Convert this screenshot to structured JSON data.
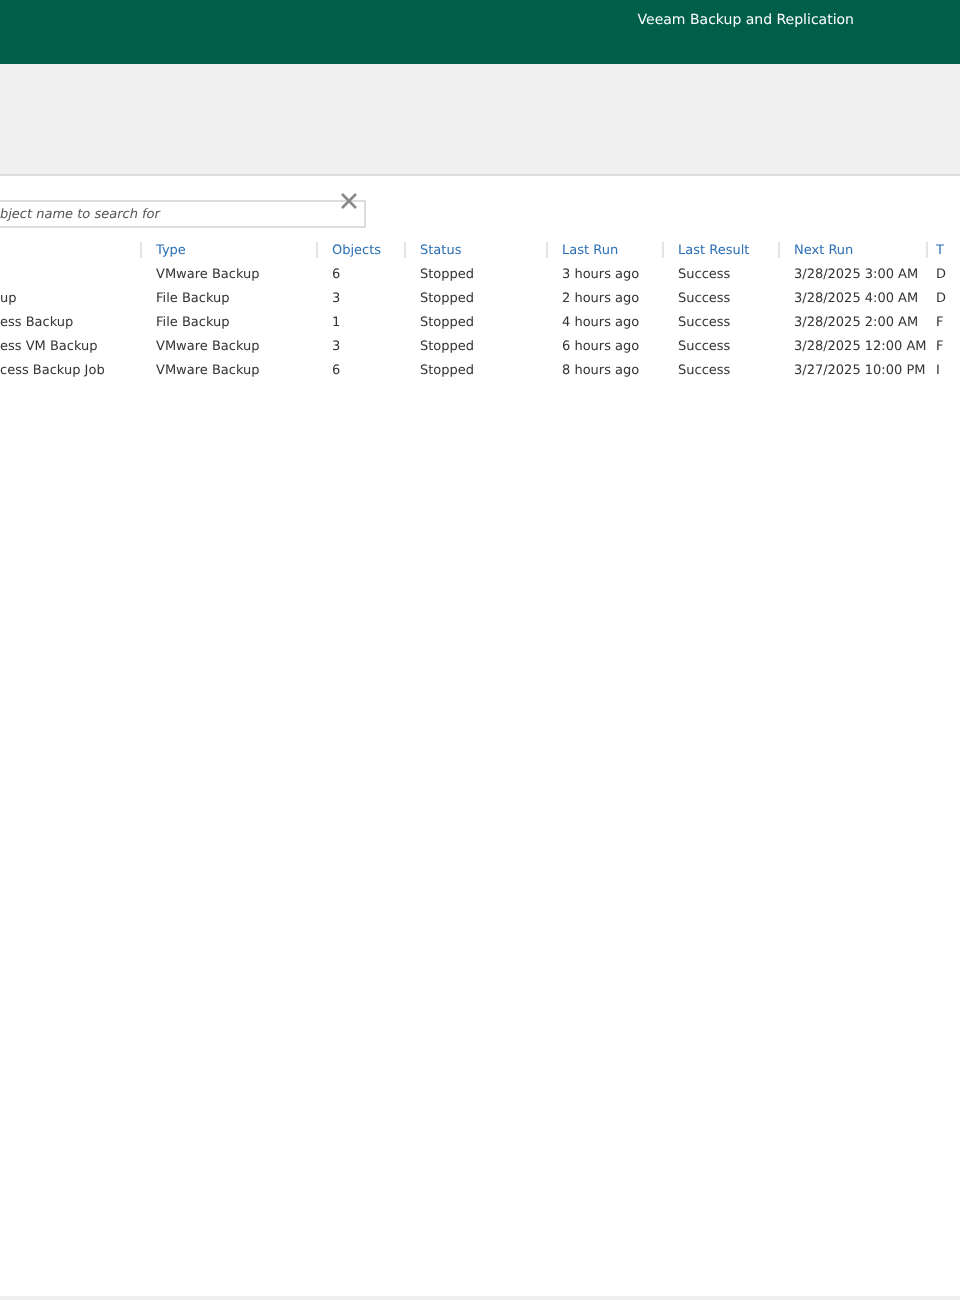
{
  "window": {
    "title": "Veeam Backup and Replication"
  },
  "search": {
    "placeholder": "bject name to search for"
  },
  "table": {
    "columns": [
      "Type",
      "Objects",
      "Status",
      "Last Run",
      "Last Result",
      "Next Run",
      "T"
    ],
    "rows": [
      {
        "name": "",
        "cells": [
          "VMware Backup",
          "6",
          "Stopped",
          "3 hours ago",
          "Success",
          "3/28/2025 3:00 AM",
          "D"
        ]
      },
      {
        "name": "up",
        "cells": [
          "File Backup",
          "3",
          "Stopped",
          "2 hours ago",
          "Success",
          "3/28/2025 4:00 AM",
          "D"
        ]
      },
      {
        "name": "ess Backup",
        "cells": [
          "File Backup",
          "1",
          "Stopped",
          "4 hours ago",
          "Success",
          "3/28/2025 2:00 AM",
          "F"
        ]
      },
      {
        "name": "ess VM Backup",
        "cells": [
          "VMware Backup",
          "3",
          "Stopped",
          "6 hours ago",
          "Success",
          "3/28/2025 12:00 AM",
          "F"
        ]
      },
      {
        "name": "cess Backup Job",
        "cells": [
          "VMware Backup",
          "6",
          "Stopped",
          "8 hours ago",
          "Success",
          "3/27/2025 10:00 PM",
          "I"
        ]
      }
    ]
  }
}
